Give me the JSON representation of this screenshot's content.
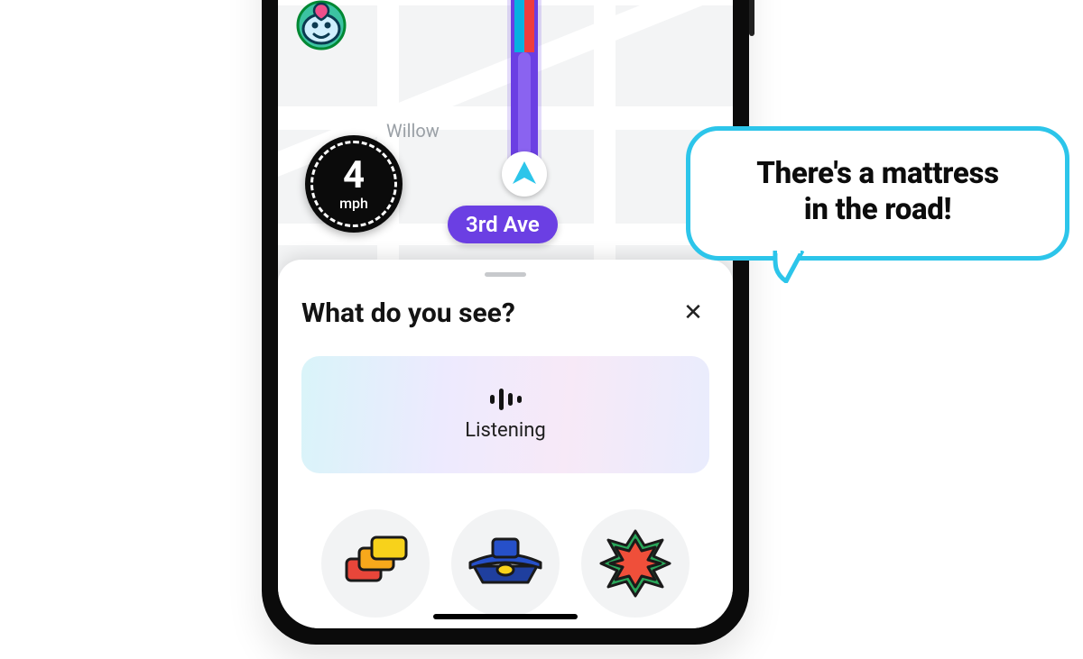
{
  "map": {
    "street_label": "Willow",
    "road_pill": "3rd Ave"
  },
  "speed": {
    "value": "4",
    "unit": "mph"
  },
  "sheet": {
    "title": "What do you see?",
    "close_glyph": "✕",
    "listen_label": "Listening"
  },
  "reports": {
    "traffic": "traffic",
    "police": "police",
    "hazard": "hazard"
  },
  "bubble": {
    "line1": "There's a mattress",
    "line2": "in the road!"
  }
}
